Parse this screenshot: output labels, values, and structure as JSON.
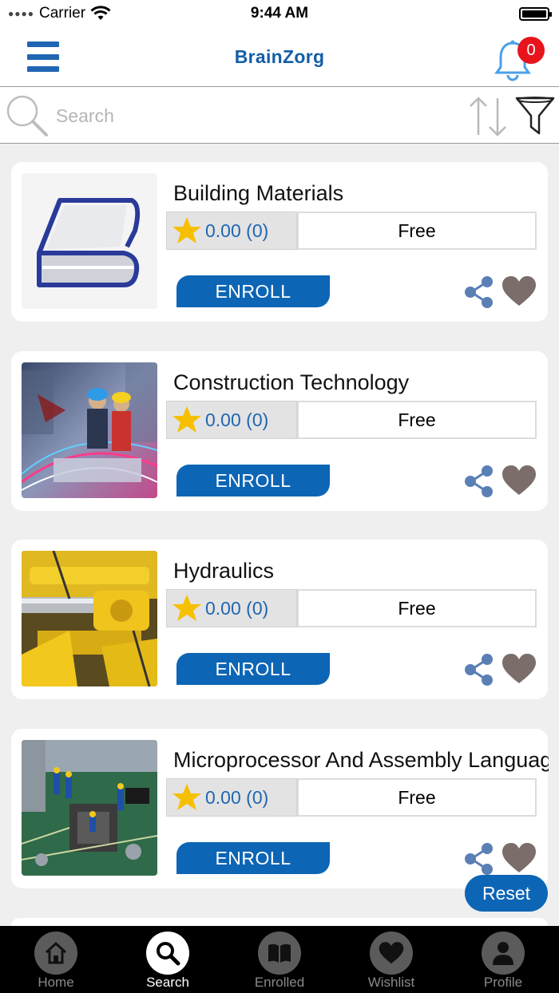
{
  "status_bar": {
    "carrier": "Carrier",
    "time": "9:44 AM"
  },
  "header": {
    "title": "BrainZorg",
    "notification_count": "0",
    "menu_icon": "hamburger-icon",
    "bell_icon": "bell-icon"
  },
  "search": {
    "placeholder": "Search",
    "value": "",
    "search_icon": "magnifier-icon",
    "sort_icon": "sort-icon",
    "filter_icon": "funnel-icon"
  },
  "courses": [
    {
      "title": "Building Materials",
      "rating": "0.00 (0)",
      "price": "Free",
      "enroll_label": "ENROLL",
      "image": "book-logo"
    },
    {
      "title": "Construction Technology",
      "rating": "0.00 (0)",
      "price": "Free",
      "enroll_label": "ENROLL",
      "image": "construction-photo"
    },
    {
      "title": "Hydraulics",
      "rating": "0.00 (0)",
      "price": "Free",
      "enroll_label": "ENROLL",
      "image": "hydraulics-photo"
    },
    {
      "title": "Microprocessor And Assembly Language",
      "rating": "0.00 (0)",
      "price": "Free",
      "enroll_label": "ENROLL",
      "image": "circuit-board-photo"
    }
  ],
  "reset_label": "Reset",
  "tabs": [
    {
      "label": "Home",
      "icon": "home-icon",
      "active": false
    },
    {
      "label": "Search",
      "icon": "search-icon",
      "active": true
    },
    {
      "label": "Enrolled",
      "icon": "book-icon",
      "active": false
    },
    {
      "label": "Wishlist",
      "icon": "heart-icon",
      "active": false
    },
    {
      "label": "Profile",
      "icon": "person-icon",
      "active": false
    }
  ],
  "colors": {
    "brand_blue": "#0d65b5",
    "badge_red": "#e8141b",
    "rating_text": "#1f66b3",
    "icon_gray": "#7b6e6a"
  }
}
